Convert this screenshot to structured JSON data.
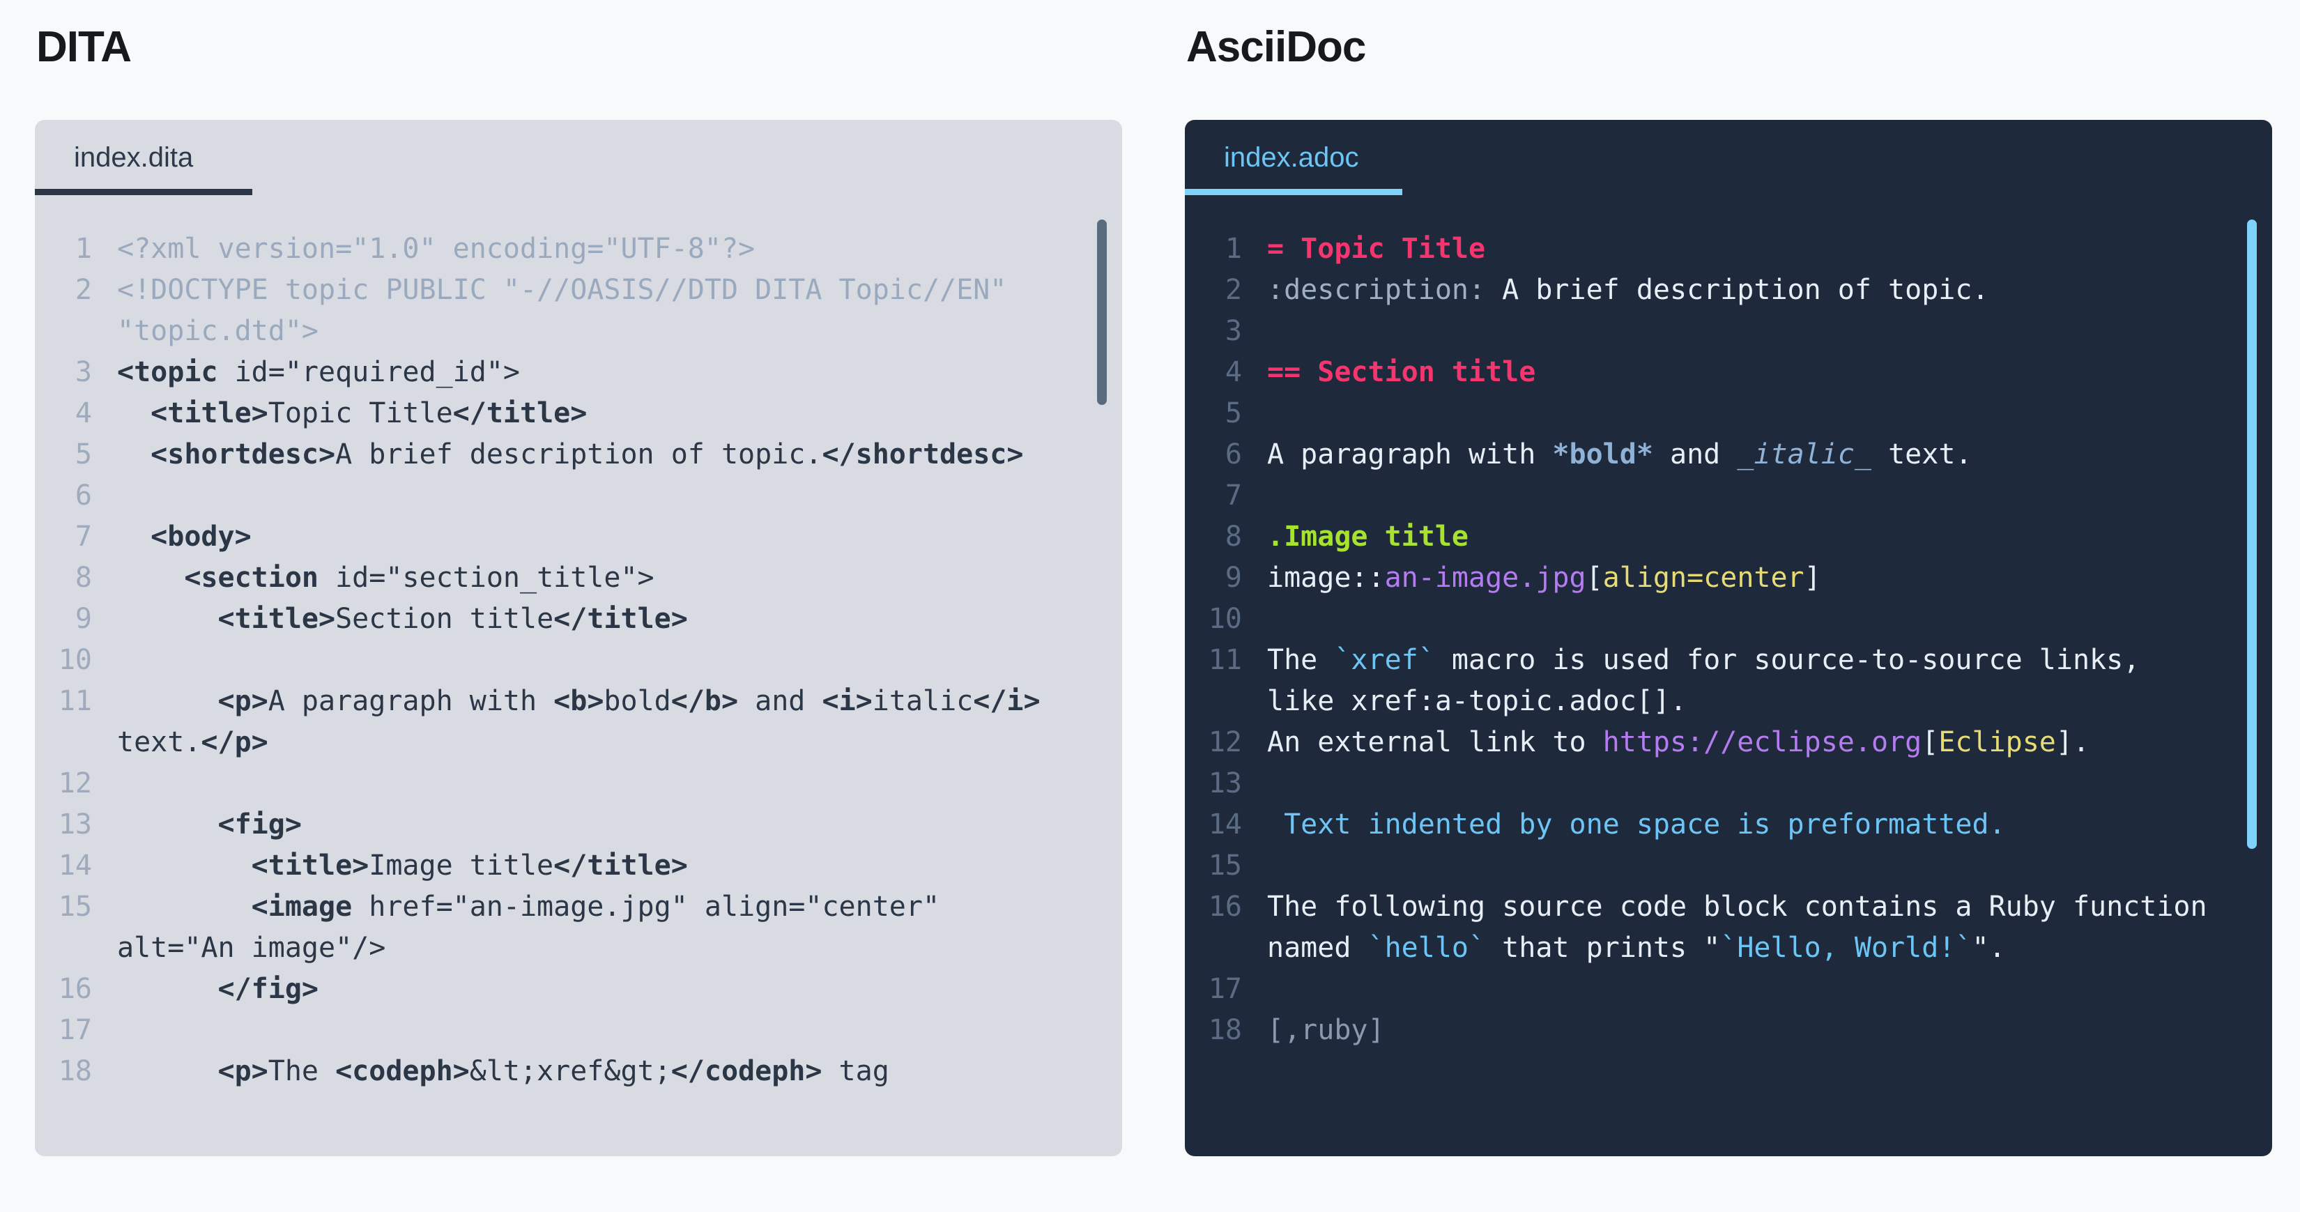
{
  "columns": [
    {
      "id": "dita",
      "title": "DITA",
      "theme": "light",
      "tab": {
        "label": "index.dita"
      },
      "scrollbar": {
        "top_pct": 1,
        "height_pct": 20
      },
      "lines": [
        {
          "n": "1",
          "tokens": [
            {
              "c": "d-comment",
              "t": "<?xml version=\"1.0\" encoding=\"UTF-8\"?>"
            }
          ]
        },
        {
          "n": "2",
          "tokens": [
            {
              "c": "d-comment",
              "t": "<!DOCTYPE topic PUBLIC \"-//OASIS//DTD DITA Topic//EN\" \"topic.dtd\">"
            }
          ]
        },
        {
          "n": "3",
          "tokens": [
            {
              "c": "d-tag",
              "t": "<topic "
            },
            {
              "c": "d-plain",
              "t": "id=\"required_id\">"
            }
          ]
        },
        {
          "n": "4",
          "tokens": [
            {
              "c": "d-plain",
              "t": "  "
            },
            {
              "c": "d-tag",
              "t": "<title>"
            },
            {
              "c": "d-plain",
              "t": "Topic Title"
            },
            {
              "c": "d-tag",
              "t": "</title>"
            }
          ]
        },
        {
          "n": "5",
          "tokens": [
            {
              "c": "d-plain",
              "t": "  "
            },
            {
              "c": "d-tag",
              "t": "<shortdesc>"
            },
            {
              "c": "d-plain",
              "t": "A brief description of topic."
            },
            {
              "c": "d-tag",
              "t": "</shortdesc>"
            }
          ]
        },
        {
          "n": "6",
          "tokens": [
            {
              "c": "d-plain",
              "t": ""
            }
          ]
        },
        {
          "n": "7",
          "tokens": [
            {
              "c": "d-plain",
              "t": "  "
            },
            {
              "c": "d-tag",
              "t": "<body>"
            }
          ]
        },
        {
          "n": "8",
          "tokens": [
            {
              "c": "d-plain",
              "t": "    "
            },
            {
              "c": "d-tag",
              "t": "<section "
            },
            {
              "c": "d-plain",
              "t": "id=\"section_title\">"
            }
          ]
        },
        {
          "n": "9",
          "tokens": [
            {
              "c": "d-plain",
              "t": "      "
            },
            {
              "c": "d-tag",
              "t": "<title>"
            },
            {
              "c": "d-plain",
              "t": "Section title"
            },
            {
              "c": "d-tag",
              "t": "</title>"
            }
          ]
        },
        {
          "n": "10",
          "tokens": [
            {
              "c": "d-plain",
              "t": ""
            }
          ]
        },
        {
          "n": "11",
          "tokens": [
            {
              "c": "d-plain",
              "t": "      "
            },
            {
              "c": "d-tag",
              "t": "<p>"
            },
            {
              "c": "d-plain",
              "t": "A paragraph with "
            },
            {
              "c": "d-tag",
              "t": "<b>"
            },
            {
              "c": "d-plain",
              "t": "bold"
            },
            {
              "c": "d-tag",
              "t": "</b>"
            },
            {
              "c": "d-plain",
              "t": " and "
            },
            {
              "c": "d-tag",
              "t": "<i>"
            },
            {
              "c": "d-plain",
              "t": "italic"
            },
            {
              "c": "d-tag",
              "t": "</i>"
            },
            {
              "c": "d-plain",
              "t": " text."
            },
            {
              "c": "d-tag",
              "t": "</p>"
            }
          ]
        },
        {
          "n": "12",
          "tokens": [
            {
              "c": "d-plain",
              "t": ""
            }
          ]
        },
        {
          "n": "13",
          "tokens": [
            {
              "c": "d-plain",
              "t": "      "
            },
            {
              "c": "d-tag",
              "t": "<fig>"
            }
          ]
        },
        {
          "n": "14",
          "tokens": [
            {
              "c": "d-plain",
              "t": "        "
            },
            {
              "c": "d-tag",
              "t": "<title>"
            },
            {
              "c": "d-plain",
              "t": "Image title"
            },
            {
              "c": "d-tag",
              "t": "</title>"
            }
          ]
        },
        {
          "n": "15",
          "tokens": [
            {
              "c": "d-plain",
              "t": "        "
            },
            {
              "c": "d-tag",
              "t": "<image "
            },
            {
              "c": "d-plain",
              "t": "href=\"an-image.jpg\" align=\"center\" alt=\"An image\"/>"
            }
          ]
        },
        {
          "n": "16",
          "tokens": [
            {
              "c": "d-plain",
              "t": "      "
            },
            {
              "c": "d-tag",
              "t": "</fig>"
            }
          ]
        },
        {
          "n": "17",
          "tokens": [
            {
              "c": "d-plain",
              "t": ""
            }
          ]
        },
        {
          "n": "18",
          "tokens": [
            {
              "c": "d-plain",
              "t": "      "
            },
            {
              "c": "d-tag",
              "t": "<p>"
            },
            {
              "c": "d-plain",
              "t": "The "
            },
            {
              "c": "d-tag",
              "t": "<codeph>"
            },
            {
              "c": "d-plain",
              "t": "&lt;xref&gt;"
            },
            {
              "c": "d-tag",
              "t": "</codeph>"
            },
            {
              "c": "d-plain",
              "t": " tag"
            }
          ]
        }
      ]
    },
    {
      "id": "asciidoc",
      "title": "AsciiDoc",
      "theme": "dark",
      "tab": {
        "label": "index.adoc"
      },
      "scrollbar": {
        "top_pct": 1,
        "height_pct": 68
      },
      "lines": [
        {
          "n": "1",
          "tokens": [
            {
              "c": "a-heading",
              "t": "= Topic Title"
            }
          ]
        },
        {
          "n": "2",
          "tokens": [
            {
              "c": "a-attr",
              "t": ":description:"
            },
            {
              "c": "a-text",
              "t": " A brief description of topic."
            }
          ]
        },
        {
          "n": "3",
          "tokens": [
            {
              "c": "a-text",
              "t": ""
            }
          ]
        },
        {
          "n": "4",
          "tokens": [
            {
              "c": "a-heading",
              "t": "== Section title"
            }
          ]
        },
        {
          "n": "5",
          "tokens": [
            {
              "c": "a-text",
              "t": ""
            }
          ]
        },
        {
          "n": "6",
          "tokens": [
            {
              "c": "a-text",
              "t": "A paragraph with "
            },
            {
              "c": "a-bold",
              "t": "*bold*"
            },
            {
              "c": "a-text",
              "t": " and "
            },
            {
              "c": "a-italic",
              "t": "_italic_"
            },
            {
              "c": "a-text",
              "t": " text."
            }
          ]
        },
        {
          "n": "7",
          "tokens": [
            {
              "c": "a-text",
              "t": ""
            }
          ]
        },
        {
          "n": "8",
          "tokens": [
            {
              "c": "a-title",
              "t": ".Image title"
            }
          ]
        },
        {
          "n": "9",
          "tokens": [
            {
              "c": "a-macro",
              "t": "image::"
            },
            {
              "c": "a-target",
              "t": "an-image.jpg"
            },
            {
              "c": "a-text",
              "t": "["
            },
            {
              "c": "a-attrlist",
              "t": "align=center"
            },
            {
              "c": "a-text",
              "t": "]"
            }
          ]
        },
        {
          "n": "10",
          "tokens": [
            {
              "c": "a-text",
              "t": ""
            }
          ]
        },
        {
          "n": "11",
          "tokens": [
            {
              "c": "a-text",
              "t": "The "
            },
            {
              "c": "a-code",
              "t": "`xref`"
            },
            {
              "c": "a-text",
              "t": " macro is used for source-to-source links, like xref:a-topic.adoc[]."
            }
          ]
        },
        {
          "n": "12",
          "tokens": [
            {
              "c": "a-text",
              "t": "An external link to "
            },
            {
              "c": "a-link",
              "t": "https://eclipse.org"
            },
            {
              "c": "a-text",
              "t": "["
            },
            {
              "c": "a-attrlist",
              "t": "Eclipse"
            },
            {
              "c": "a-text",
              "t": "]."
            }
          ]
        },
        {
          "n": "13",
          "tokens": [
            {
              "c": "a-text",
              "t": ""
            }
          ]
        },
        {
          "n": "14",
          "tokens": [
            {
              "c": "a-pre",
              "t": " Text indented by one space is preformatted."
            }
          ]
        },
        {
          "n": "15",
          "tokens": [
            {
              "c": "a-text",
              "t": ""
            }
          ]
        },
        {
          "n": "16",
          "tokens": [
            {
              "c": "a-text",
              "t": "The following source code block contains a Ruby function named "
            },
            {
              "c": "a-code",
              "t": "`hello`"
            },
            {
              "c": "a-text",
              "t": " that prints \""
            },
            {
              "c": "a-code",
              "t": "`Hello, World!`"
            },
            {
              "c": "a-text",
              "t": "\"."
            }
          ]
        },
        {
          "n": "17",
          "tokens": [
            {
              "c": "a-text",
              "t": ""
            }
          ]
        },
        {
          "n": "18",
          "tokens": [
            {
              "c": "a-meta",
              "t": "[,ruby]"
            }
          ]
        }
      ]
    }
  ],
  "colors": {
    "page_background": "#f8f9fb",
    "light_panel": "#d8dce2",
    "dark_panel": "#1e293b",
    "light_accent": "#2b3646",
    "dark_accent": "#7fd2f9",
    "heading_pink": "#f6356e",
    "title_green": "#a6e22e",
    "target_purple": "#b47cf0",
    "attr_yellow": "#e6db74"
  }
}
